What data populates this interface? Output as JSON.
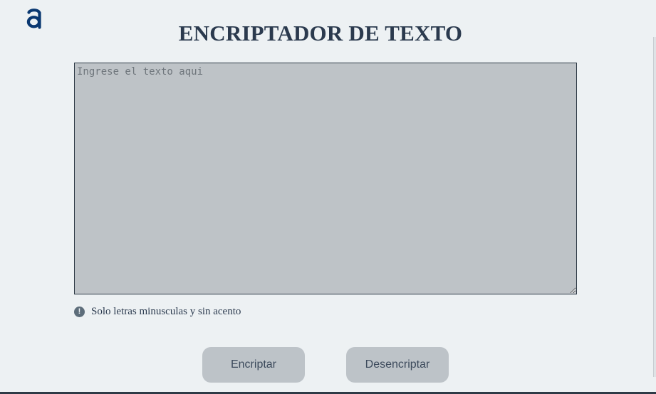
{
  "header": {
    "logo_icon": "alura-a-logo-icon",
    "title": "ENCRIPTADOR DE TEXTO"
  },
  "editor": {
    "value": "",
    "placeholder": "Ingrese el texto aqui"
  },
  "hint": {
    "icon": "exclamation-circle-icon",
    "text": "Solo letras minusculas y sin acento"
  },
  "buttons": {
    "encrypt_label": "Encriptar",
    "decrypt_label": "Desencriptar"
  },
  "colors": {
    "background": "#edf1f3",
    "brand_blue": "#0a3871",
    "title_text": "#2b3a4e",
    "textarea_bg": "#bec3c7",
    "button_bg": "#bdc3c8"
  }
}
